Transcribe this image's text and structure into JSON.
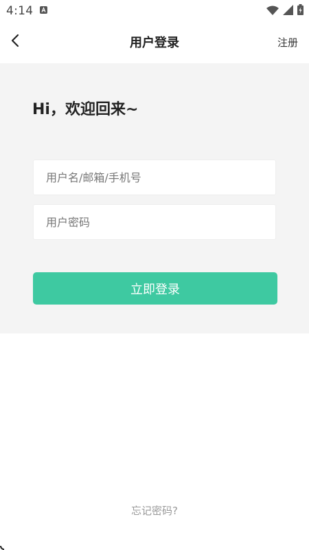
{
  "status_bar": {
    "time": "4:14",
    "icons": [
      "app-notification-icon",
      "wifi-icon",
      "signal-icon",
      "battery-icon"
    ]
  },
  "nav": {
    "back_icon": "chevron-left-icon",
    "title": "用户登录",
    "register_label": "注册"
  },
  "login": {
    "greeting": "Hi，欢迎回来~",
    "username_placeholder": "用户名/邮箱/手机号",
    "username_value": "",
    "password_placeholder": "用户密码",
    "password_value": "",
    "submit_label": "立即登录"
  },
  "footer": {
    "forgot_password": "忘记密码?"
  },
  "colors": {
    "accent": "#3ec9a1",
    "panel_background": "#f4f4f4",
    "hint_text": "#999999"
  }
}
